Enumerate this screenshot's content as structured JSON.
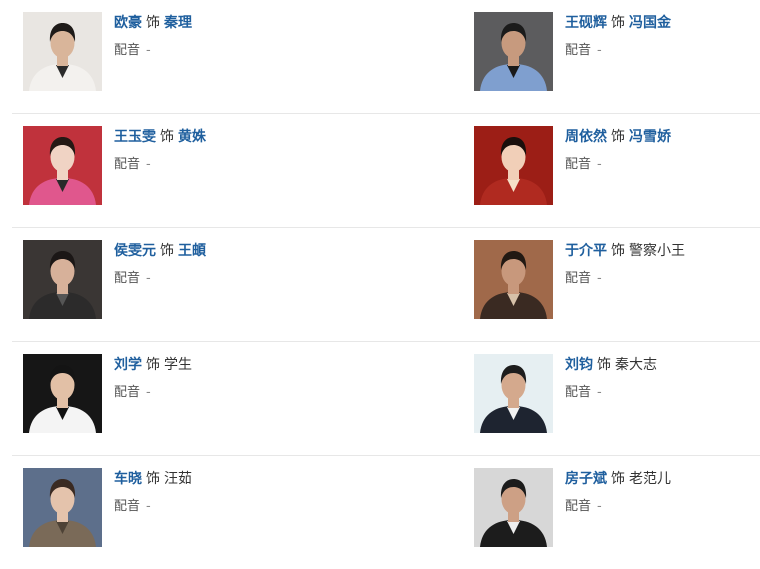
{
  "cast": {
    "connector": "饰",
    "dub_label": "配音",
    "dub_empty": "-",
    "rows": [
      [
        {
          "actor": "欧豪",
          "role": "秦理",
          "role_linked": true,
          "photo": {
            "bg": "#e9e6e2",
            "skin": "#d9b59a",
            "hair": "#1e1a18",
            "top": "#f3f1ee",
            "accent": "#2a2a2a"
          }
        },
        {
          "actor": "王砚辉",
          "role": "冯国金",
          "role_linked": true,
          "photo": {
            "bg": "#5c5c5e",
            "skin": "#c79a7e",
            "hair": "#1b1b1b",
            "top": "#7f9fcf",
            "accent": "#1a1a1a"
          }
        }
      ],
      [
        {
          "actor": "王玉雯",
          "role": "黄姝",
          "role_linked": true,
          "photo": {
            "bg": "#c0323c",
            "skin": "#f0d3c4",
            "hair": "#241814",
            "top": "#e0578d",
            "accent": "#2a2a2a"
          }
        },
        {
          "actor": "周依然",
          "role": "冯雪娇",
          "role_linked": true,
          "photo": {
            "bg": "#9c1e16",
            "skin": "#f1cfb8",
            "hair": "#1a0f0c",
            "top": "#b02a20",
            "accent": "#f6e2c8"
          }
        }
      ],
      [
        {
          "actor": "侯雯元",
          "role": "王頔",
          "role_linked": true,
          "photo": {
            "bg": "#3a3634",
            "skin": "#d7b19a",
            "hair": "#1b1716",
            "top": "#2c2b2b",
            "accent": "#555555"
          }
        },
        {
          "actor": "于介平",
          "role": "警察小王",
          "role_linked": false,
          "photo": {
            "bg": "#a0694a",
            "skin": "#c8987c",
            "hair": "#221913",
            "top": "#3a2a22",
            "accent": "#d6c0a8"
          }
        }
      ],
      [
        {
          "actor": "刘学",
          "role": "学生",
          "role_linked": false,
          "photo": {
            "bg": "#161616",
            "skin": "#e2c0a6",
            "hair": "#141414",
            "top": "#f4f4f4",
            "accent": "#111111"
          }
        },
        {
          "actor": "刘钧",
          "role": "秦大志",
          "role_linked": false,
          "photo": {
            "bg": "#e6eff2",
            "skin": "#d4a98d",
            "hair": "#1d1d1d",
            "top": "#1e2430",
            "accent": "#f2f2f2"
          }
        }
      ],
      [
        {
          "actor": "车晓",
          "role": "汪茹",
          "role_linked": false,
          "photo": {
            "bg": "#5d6f8b",
            "skin": "#e4c3ac",
            "hair": "#3a2a22",
            "top": "#7a6a58",
            "accent": "#4e4236"
          }
        },
        {
          "actor": "房子斌",
          "role": "老范儿",
          "role_linked": false,
          "photo": {
            "bg": "#d7d7d7",
            "skin": "#cda085",
            "hair": "#1b1b1b",
            "top": "#1c1c1c",
            "accent": "#eeeeee"
          }
        }
      ]
    ]
  }
}
